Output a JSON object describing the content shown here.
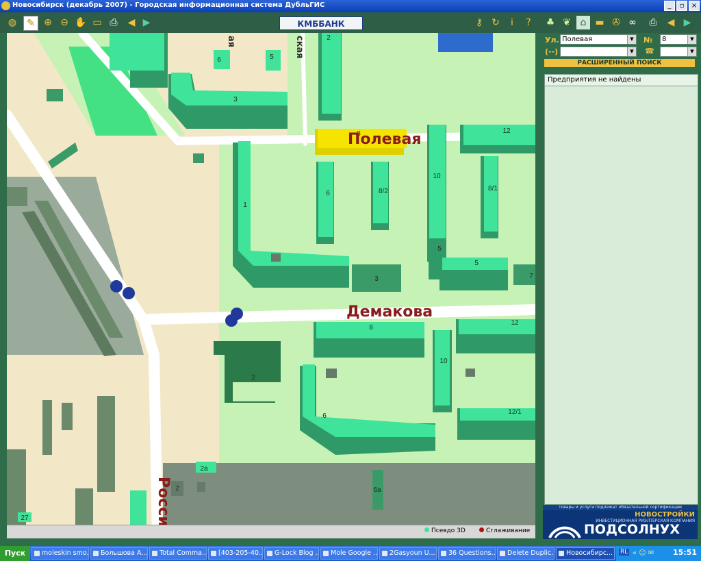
{
  "window": {
    "title": "Новосибирск (декабрь 2007) - Городская информационная система ДубльГИС",
    "min": "_",
    "max": "▫",
    "close": "×"
  },
  "toolbar": {
    "left_icons": [
      "globe-icon",
      "pen-icon",
      "zoom-in-icon",
      "zoom-out-icon",
      "hand-icon",
      "ruler-icon",
      "print-icon",
      "back-arrow-icon",
      "forward-arrow-icon"
    ],
    "bank_label": "КМББАНК",
    "right_icons": [
      "key-icon",
      "refresh-icon",
      "info-icon",
      "help-icon"
    ],
    "panel_icons": [
      "tree-icon",
      "leaf-icon",
      "houses-icon",
      "bus-icon",
      "broom-icon",
      "binoculars-icon",
      "print-icon",
      "back-arrow-icon",
      "forward-arrow-icon"
    ]
  },
  "panel": {
    "street_label": "Ул.",
    "street_value": "Полевая",
    "house_label": "№",
    "house_value": "8",
    "phone_label": "(--)",
    "phone_icon_label": "☎",
    "advanced_search": "РАСШИРЕННЫЙ ПОИСК",
    "results_text": "Предприятия не найдены"
  },
  "map": {
    "streets": [
      {
        "name": "Полевая"
      },
      {
        "name": "Демакова"
      },
      {
        "name": "Росси"
      },
      {
        "name": "ская"
      },
      {
        "name": "ая"
      }
    ],
    "buildings": [
      "8",
      "12",
      "6",
      "8/2",
      "10",
      "8/1",
      "1",
      "5",
      "5",
      "3",
      "7",
      "3",
      "6",
      "5",
      "2",
      "8",
      "12",
      "10",
      "2",
      "6",
      "12/1",
      "2а",
      "2",
      "6а",
      "27"
    ]
  },
  "statusbar": {
    "pseudo3d": "Псевдо 3D",
    "smoothing": "Сглаживание"
  },
  "ad": {
    "top_text": "товары и услуги подлежат обязательной сертификации",
    "novostroiki": "НОВОСТРОЙКИ",
    "company_type": "ИНВЕСТИЦИОННАЯ РИЭЛТЕРСКАЯ КОМПАНИЯ",
    "company": "ПОДСОЛНУХ"
  },
  "taskbar": {
    "start": "Пуск",
    "tasks": [
      "moleskin smo...",
      "Большова А...",
      "Total Comma...",
      "[403-205-40...",
      "G-Lock Blog ...",
      "Mole Google ...",
      "2Gasyoun U...",
      "36 Questions...",
      "Delete Duplic...",
      "Новосибирс..."
    ],
    "lang": "RL",
    "clock": "15:51"
  },
  "colors": {
    "building": "#3fe39a",
    "building_dark": "#2f9a68",
    "selected": "#f5e400",
    "road": "#ffffff",
    "label": "#8a1c1c"
  }
}
